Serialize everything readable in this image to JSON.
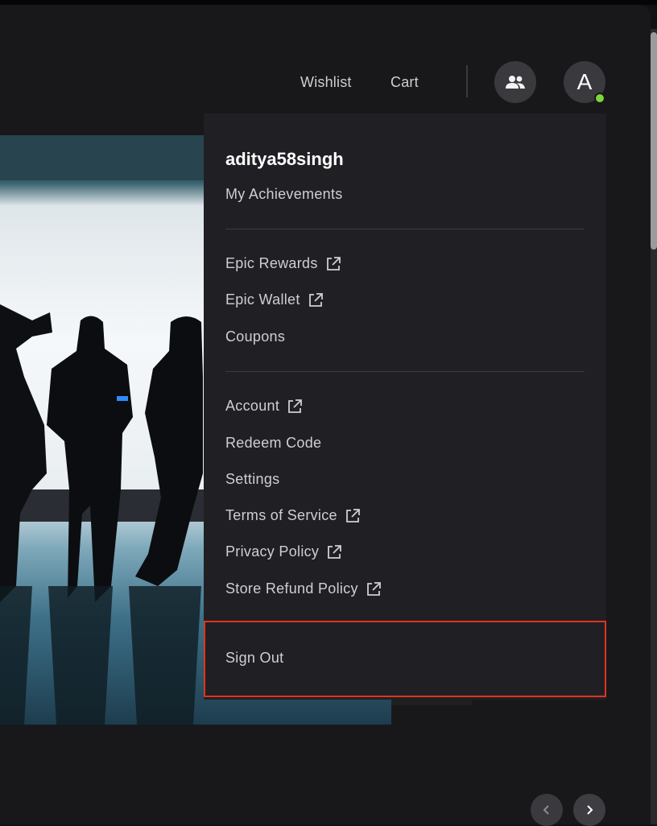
{
  "header": {
    "wishlist_label": "Wishlist",
    "cart_label": "Cart",
    "avatar_letter": "A",
    "online_color": "#7cd63a"
  },
  "menu": {
    "username": "aditya58singh",
    "achievements": "My Achievements",
    "group1": [
      {
        "label": "Epic Rewards",
        "external": true
      },
      {
        "label": "Epic Wallet",
        "external": true
      },
      {
        "label": "Coupons",
        "external": false
      }
    ],
    "group2": [
      {
        "label": "Account",
        "external": true
      },
      {
        "label": "Redeem Code",
        "external": false
      },
      {
        "label": "Settings",
        "external": false
      },
      {
        "label": "Terms of Service",
        "external": true
      },
      {
        "label": "Privacy Policy",
        "external": true
      },
      {
        "label": "Store Refund Policy",
        "external": true
      }
    ],
    "sign_out": "Sign Out",
    "highlight_color": "#e2341d"
  },
  "icons": {
    "friends": "friends-icon",
    "external": "external-link-icon",
    "prev": "chevron-left-icon",
    "next": "chevron-right-icon"
  }
}
